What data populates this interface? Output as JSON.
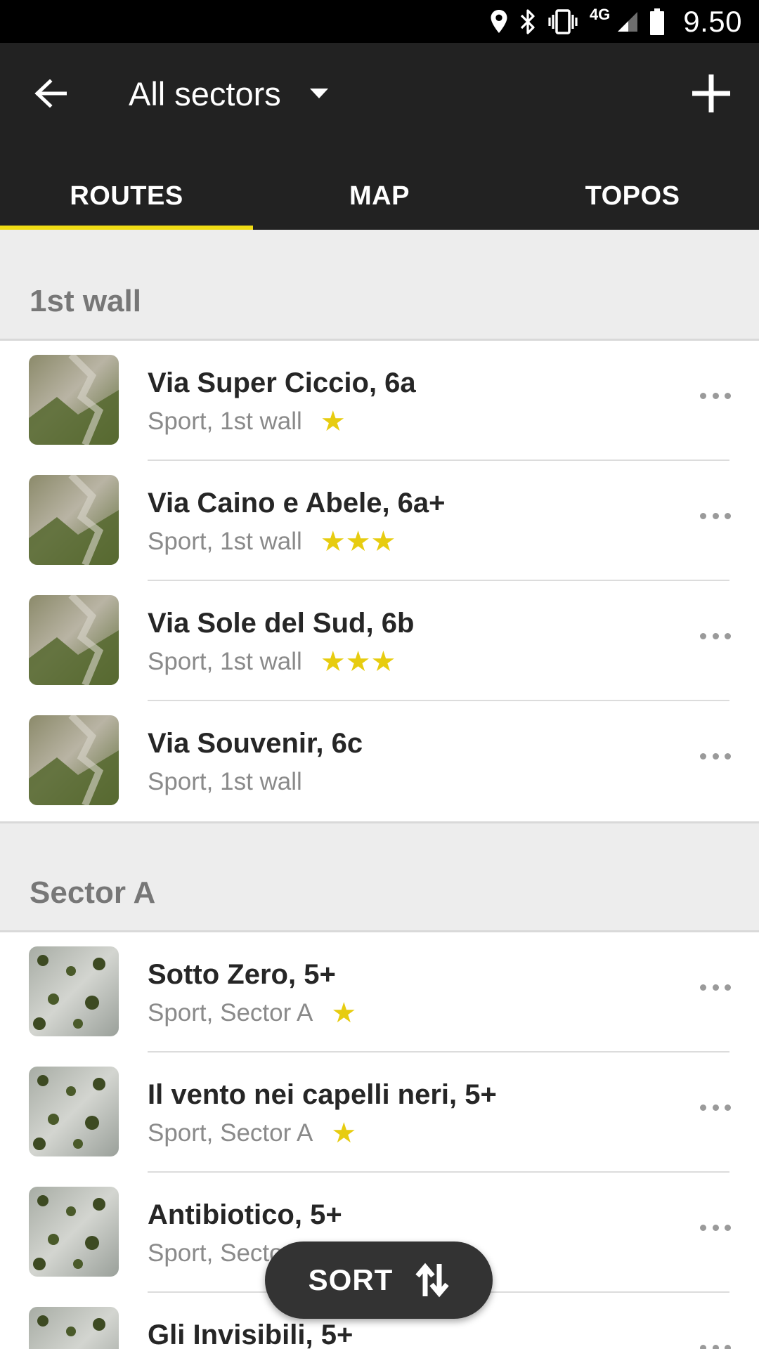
{
  "status_bar": {
    "time": "9.50",
    "network": "4G",
    "icons": [
      "location-icon",
      "bluetooth-icon",
      "vibrate-icon",
      "signal-icon",
      "battery-icon"
    ]
  },
  "app_bar": {
    "title": "All sectors",
    "back_icon": "arrow-left-icon",
    "dropdown_icon": "caret-down-icon",
    "add_icon": "plus-icon"
  },
  "tabs": [
    {
      "label": "ROUTES",
      "active": true
    },
    {
      "label": "MAP",
      "active": false
    },
    {
      "label": "TOPOS",
      "active": false
    }
  ],
  "sections": [
    {
      "title": "1st wall",
      "routes": [
        {
          "name": "Via Super Ciccio, 6a",
          "sub": "Sport, 1st wall",
          "stars": "★"
        },
        {
          "name": "Via Caino e Abele, 6a+",
          "sub": "Sport, 1st wall",
          "stars": "★★★"
        },
        {
          "name": "Via Sole del Sud, 6b",
          "sub": "Sport, 1st wall",
          "stars": "★★★"
        },
        {
          "name": "Via Souvenir, 6c",
          "sub": "Sport, 1st wall",
          "stars": ""
        }
      ]
    },
    {
      "title": "Sector A",
      "routes": [
        {
          "name": "Sotto Zero, 5+",
          "sub": "Sport, Sector A",
          "stars": "★"
        },
        {
          "name": "Il vento nei capelli neri, 5+",
          "sub": "Sport, Sector A",
          "stars": "★"
        },
        {
          "name": "Antibiotico, 5+",
          "sub": "Sport, Sector A",
          "stars": ""
        },
        {
          "name": "Gli Invisibili, 5+",
          "sub": "",
          "stars": ""
        }
      ]
    }
  ],
  "sort_button": {
    "label": "SORT",
    "icon": "sort-arrows-icon"
  },
  "colors": {
    "accent": "#f0dc14",
    "star": "#e7cc10",
    "app_bar": "#222222",
    "section_bg": "#ededed"
  }
}
